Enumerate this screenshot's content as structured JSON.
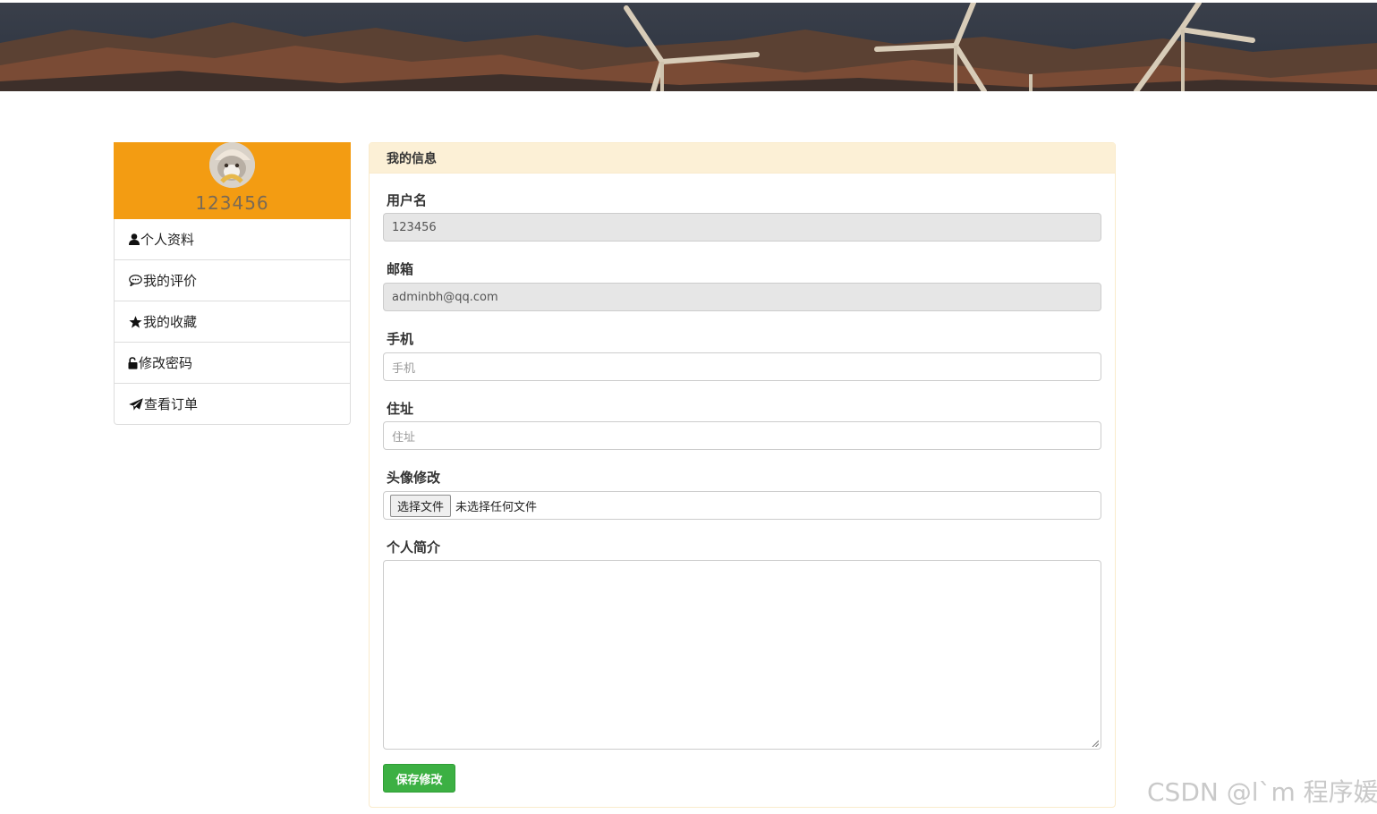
{
  "sidebar": {
    "username": "123456",
    "items": [
      {
        "label": "个人资料",
        "icon": "user-icon"
      },
      {
        "label": "我的评价",
        "icon": "comment-icon"
      },
      {
        "label": "我的收藏",
        "icon": "star-icon"
      },
      {
        "label": "修改密码",
        "icon": "unlock-icon"
      },
      {
        "label": "查看订单",
        "icon": "send-icon"
      }
    ]
  },
  "panel": {
    "title": "我的信息",
    "fields": {
      "username_label": "用户名",
      "username_value": "123456",
      "email_label": "邮箱",
      "email_value": "adminbh@qq.com",
      "phone_label": "手机",
      "phone_placeholder": "手机",
      "address_label": "住址",
      "address_placeholder": "住址",
      "avatar_label": "头像修改",
      "file_button": "选择文件",
      "file_status": "未选择任何文件",
      "bio_label": "个人简介"
    },
    "save_label": "保存修改"
  },
  "watermark": "CSDN @l`m 程序媛",
  "colors": {
    "profile_header": "#f39c12",
    "panel_heading": "#fcf0d6",
    "save_button": "#3cb043"
  }
}
